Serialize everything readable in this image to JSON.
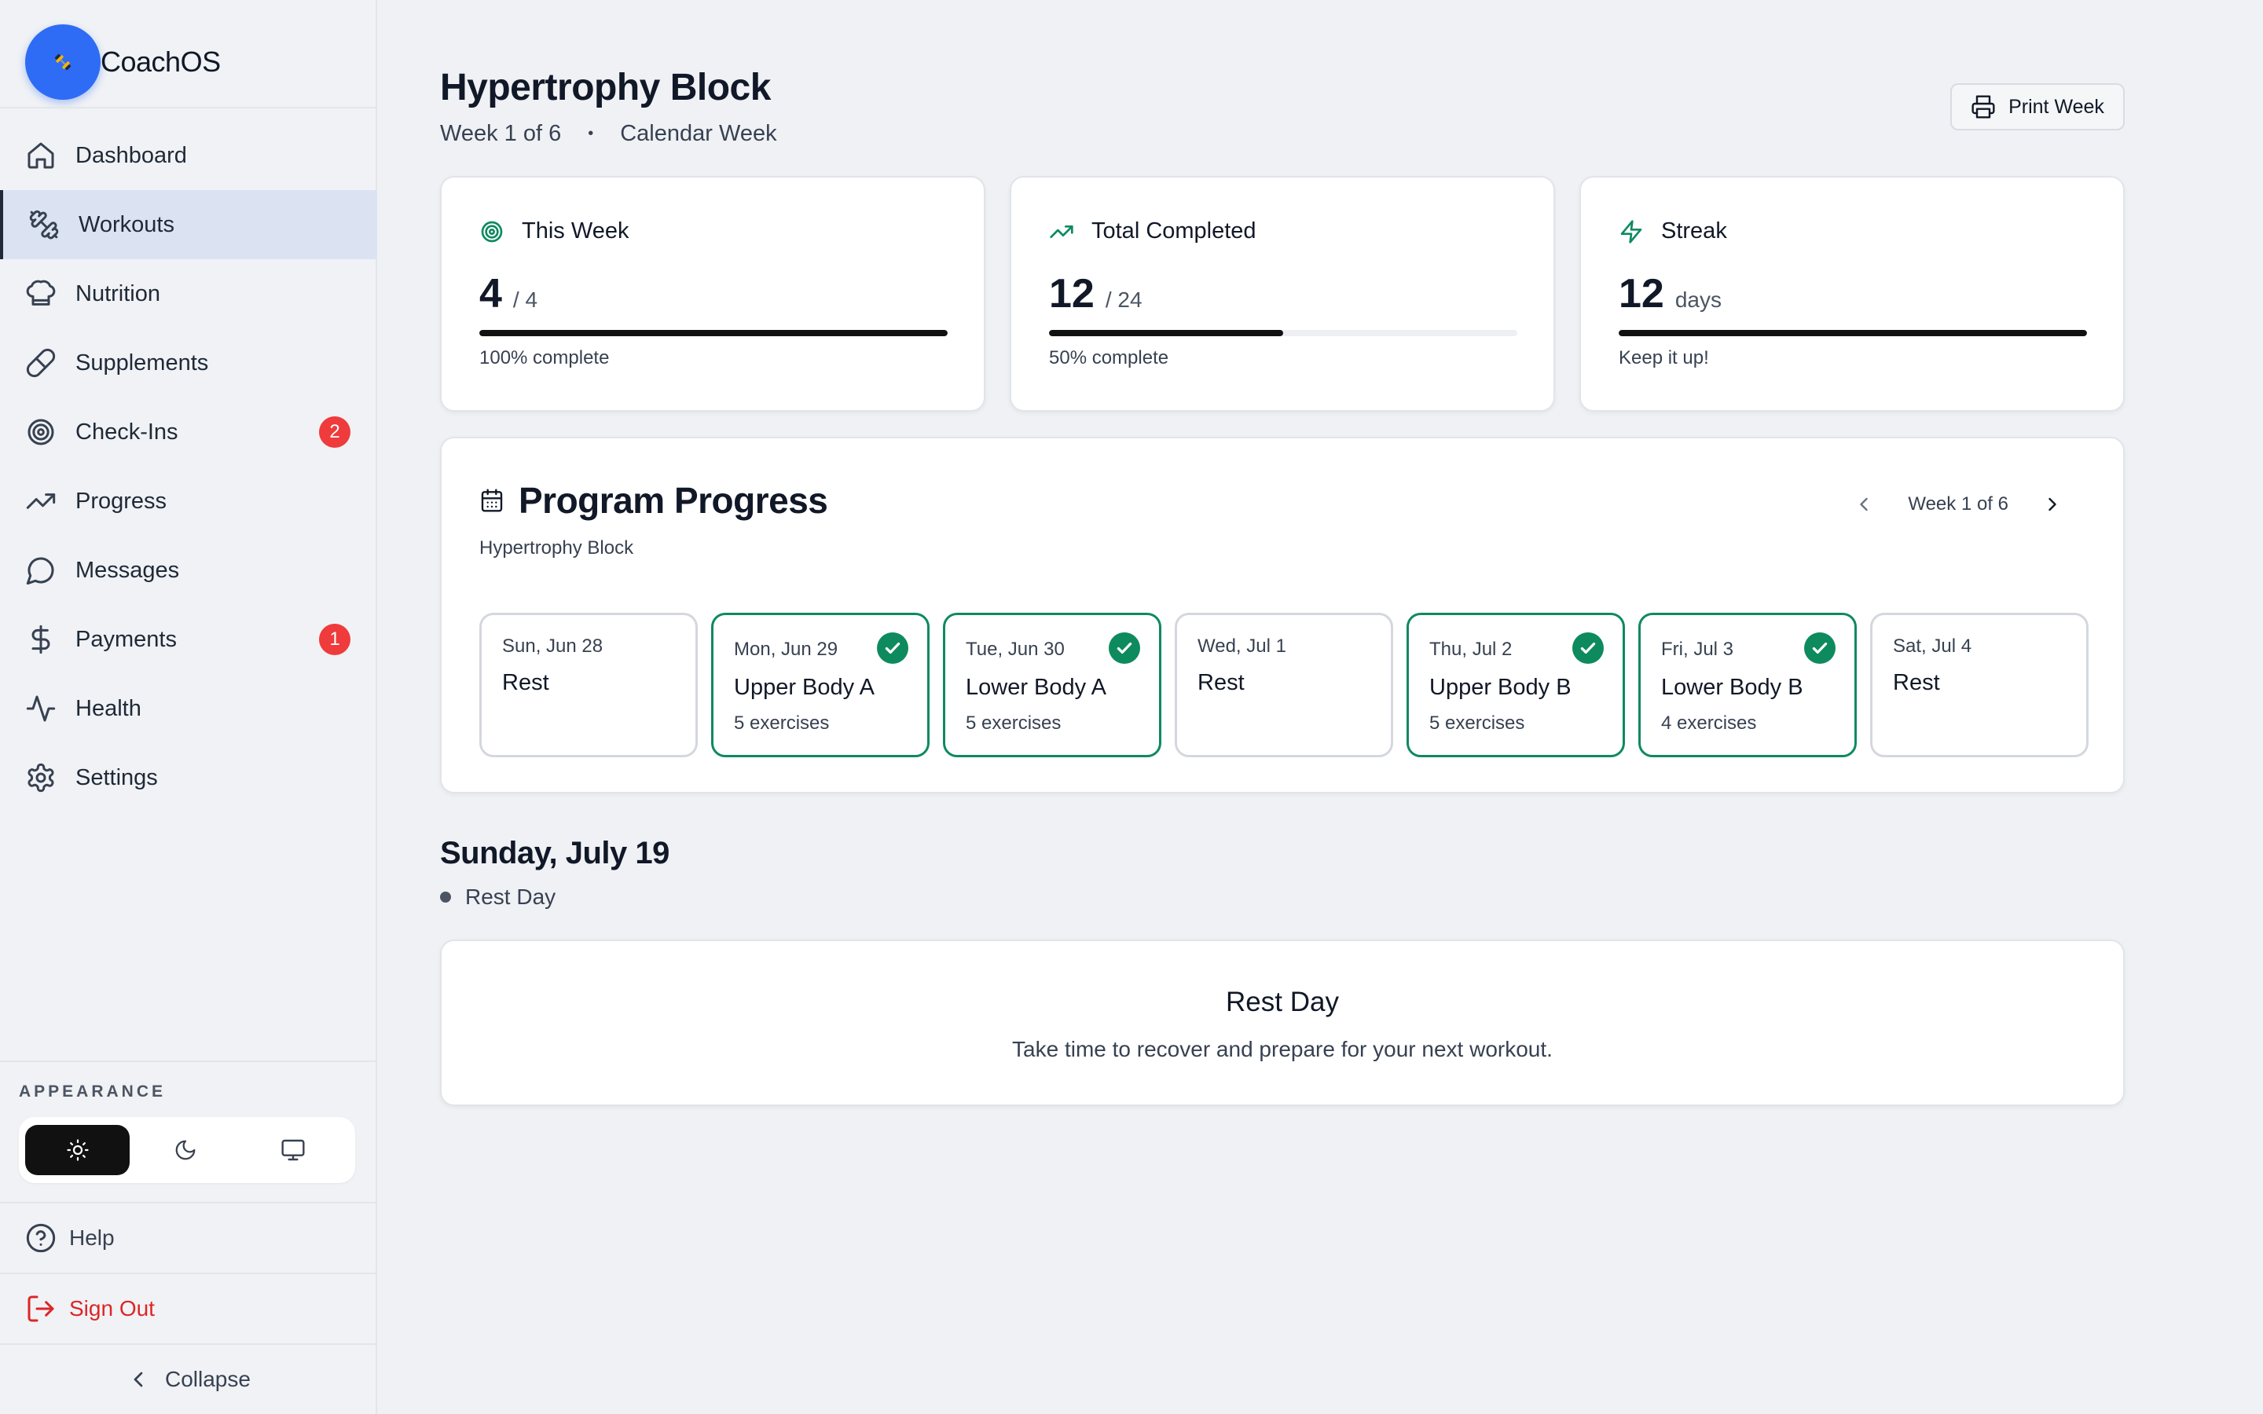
{
  "app": {
    "name": "CoachOS"
  },
  "sidebar": {
    "items": [
      {
        "label": "Dashboard",
        "icon": "home-icon"
      },
      {
        "label": "Workouts",
        "icon": "dumbbell-icon",
        "active": true
      },
      {
        "label": "Nutrition",
        "icon": "chef-hat-icon"
      },
      {
        "label": "Supplements",
        "icon": "pill-icon"
      },
      {
        "label": "Check-Ins",
        "icon": "target-icon",
        "badge": "2"
      },
      {
        "label": "Progress",
        "icon": "trending-up-icon"
      },
      {
        "label": "Messages",
        "icon": "message-circle-icon"
      },
      {
        "label": "Payments",
        "icon": "dollar-icon",
        "badge": "1"
      },
      {
        "label": "Health",
        "icon": "activity-icon"
      },
      {
        "label": "Settings",
        "icon": "gear-icon"
      }
    ],
    "appearance_label": "APPEARANCE",
    "theme_options": [
      "light",
      "dark",
      "system"
    ],
    "theme_selected": "light",
    "help_label": "Help",
    "signout_label": "Sign Out",
    "collapse_label": "Collapse"
  },
  "header": {
    "title": "Hypertrophy Block",
    "week": "Week 1 of 6",
    "view": "Calendar Week",
    "print_label": "Print Week"
  },
  "stats": [
    {
      "label": "This Week",
      "value": "4",
      "unit": "/ 4",
      "progress": 1.0,
      "note": "100% complete",
      "icon": "target-icon"
    },
    {
      "label": "Total Completed",
      "value": "12",
      "unit": "/ 24",
      "progress": 0.5,
      "note": "50% complete",
      "icon": "trending-up-icon"
    },
    {
      "label": "Streak",
      "value": "12",
      "unit": "days",
      "progress": 1.0,
      "note": "Keep it up!",
      "icon": "zap-icon"
    }
  ],
  "program": {
    "title": "Program Progress",
    "subtitle": "Hypertrophy Block",
    "week_label": "Week 1 of 6",
    "days": [
      {
        "date": "Sun, Jun 28",
        "title": "Rest",
        "exercises": "",
        "done": false
      },
      {
        "date": "Mon, Jun 29",
        "title": "Upper Body A",
        "exercises": "5 exercises",
        "done": true
      },
      {
        "date": "Tue, Jun 30",
        "title": "Lower Body A",
        "exercises": "5 exercises",
        "done": true
      },
      {
        "date": "Wed, Jul 1",
        "title": "Rest",
        "exercises": "",
        "done": false
      },
      {
        "date": "Thu, Jul 2",
        "title": "Upper Body B",
        "exercises": "5 exercises",
        "done": true
      },
      {
        "date": "Fri, Jul 3",
        "title": "Lower Body B",
        "exercises": "4 exercises",
        "done": true
      },
      {
        "date": "Sat, Jul 4",
        "title": "Rest",
        "exercises": "",
        "done": false
      }
    ]
  },
  "selected_day": {
    "date": "Sunday, July 19",
    "kind": "Rest Day",
    "card_title": "Rest Day",
    "card_desc": "Take time to recover and prepare for your next workout."
  },
  "colors": {
    "accent_green": "#0e8a5f",
    "brand_blue": "#2e6cf6",
    "badge_red": "#ef3b3b",
    "signout_red": "#dc2626"
  }
}
